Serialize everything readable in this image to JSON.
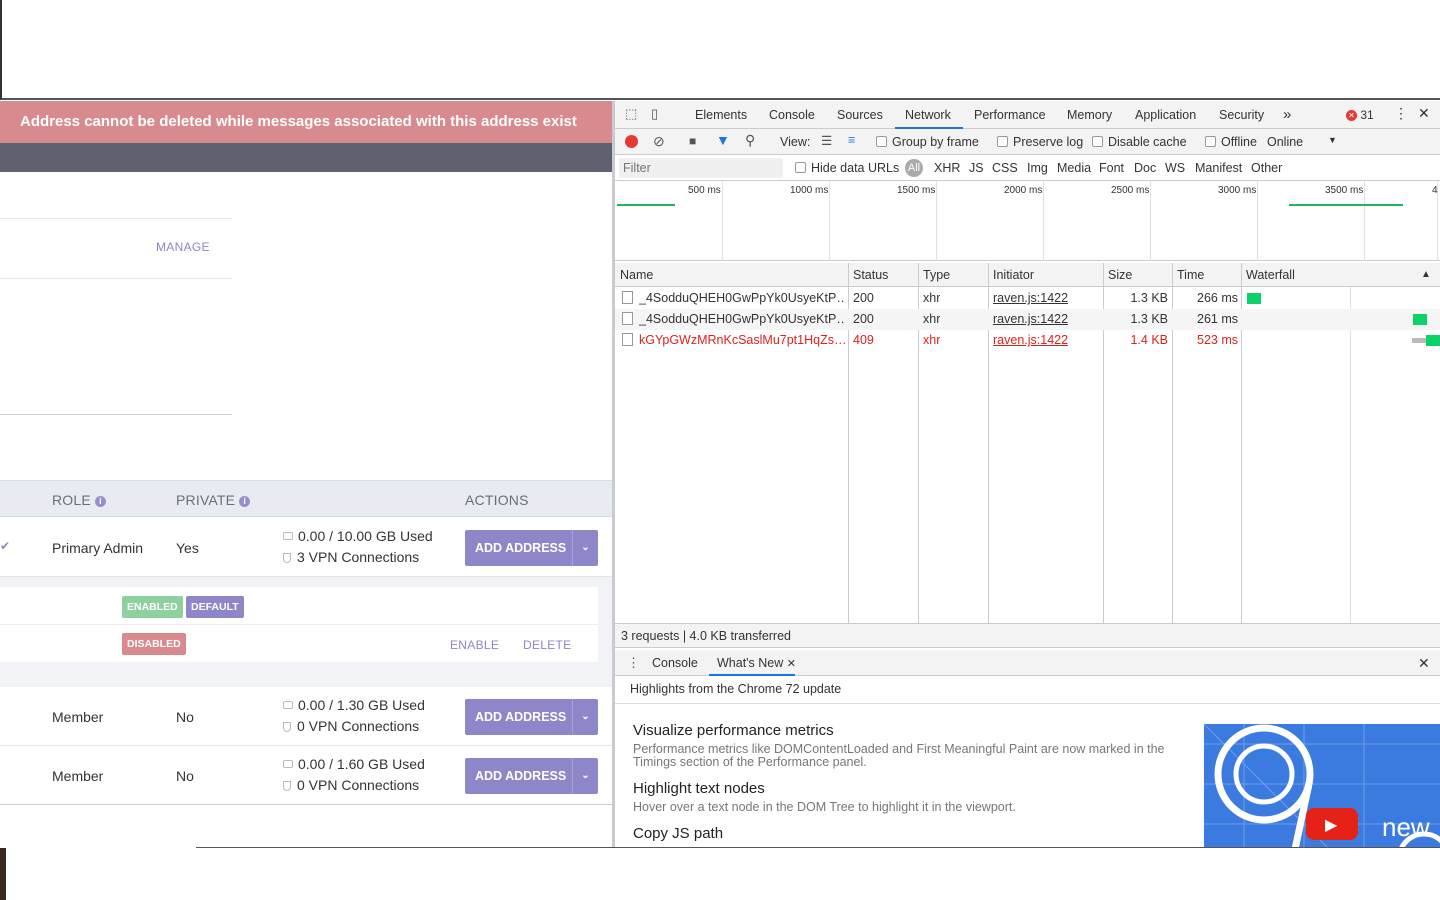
{
  "app": {
    "alert_text": "Address cannot be deleted while messages associated with this address exist",
    "manage_label": "MANAGE",
    "table_headers": {
      "role": "ROLE",
      "private": "PRIVATE",
      "actions": "ACTIONS"
    },
    "members": [
      {
        "role": "Primary Admin",
        "private": "Yes",
        "storage": "0.00 / 10.00 GB Used",
        "vpn": "3 VPN Connections",
        "action": "ADD ADDRESS"
      },
      {
        "role": "Member",
        "private": "No",
        "storage": "0.00 / 1.30 GB Used",
        "vpn": "0 VPN Connections",
        "action": "ADD ADDRESS"
      },
      {
        "role": "Member",
        "private": "No",
        "storage": "0.00 / 1.60 GB Used",
        "vpn": "0 VPN Connections",
        "action": "ADD ADDRESS"
      }
    ],
    "addresses": {
      "badge_enabled": "ENABLED",
      "badge_default": "DEFAULT",
      "badge_disabled": "DISABLED",
      "enable_label": "ENABLE",
      "delete_label": "DELETE"
    },
    "colors": {
      "alert": "#d98a8e",
      "accent": "#8d86c9",
      "enabled": "#8fd19e",
      "disabled": "#d98a8e"
    }
  },
  "devtools": {
    "tabs": [
      "Elements",
      "Console",
      "Sources",
      "Network",
      "Performance",
      "Memory",
      "Application",
      "Security"
    ],
    "active_tab": "Network",
    "more_tabs": "»",
    "error_count": "31",
    "toolbar": {
      "view_label": "View:",
      "group_by_frame": "Group by frame",
      "preserve_log": "Preserve log",
      "disable_cache": "Disable cache",
      "offline": "Offline",
      "throttle": "Online"
    },
    "filter": {
      "placeholder": "Filter",
      "hide_data_urls": "Hide data URLs",
      "all": "All",
      "types": [
        "XHR",
        "JS",
        "CSS",
        "Img",
        "Media",
        "Font",
        "Doc",
        "WS",
        "Manifest",
        "Other"
      ]
    },
    "overview_ticks": [
      "500 ms",
      "1000 ms",
      "1500 ms",
      "2000 ms",
      "2500 ms",
      "3000 ms",
      "3500 ms",
      "4"
    ],
    "columns": {
      "name": "Name",
      "status": "Status",
      "type": "Type",
      "initiator": "Initiator",
      "size": "Size",
      "time": "Time",
      "waterfall": "Waterfall"
    },
    "requests": [
      {
        "name": "_4SodduQHEH0GwPpYk0UsyeKtP…",
        "status": "200",
        "type": "xhr",
        "initiator": "raven.js:1422",
        "size": "1.3 KB",
        "time": "266 ms",
        "error": false
      },
      {
        "name": "_4SodduQHEH0GwPpYk0UsyeKtP…",
        "status": "200",
        "type": "xhr",
        "initiator": "raven.js:1422",
        "size": "1.3 KB",
        "time": "261 ms",
        "error": false
      },
      {
        "name": "kGYpGWzMRnKcSaslMu7pt1HqZs…",
        "status": "409",
        "type": "xhr",
        "initiator": "raven.js:1422",
        "size": "1.4 KB",
        "time": "523 ms",
        "error": true
      }
    ],
    "status_bar": "3 requests | 4.0 KB transferred",
    "drawer": {
      "tabs": [
        "Console",
        "What's New"
      ],
      "active": "What's New",
      "subtitle": "Highlights from the Chrome 72 update",
      "items": [
        {
          "title": "Visualize performance metrics",
          "desc": "Performance metrics like DOMContentLoaded and First Meaningful Paint are now marked in the Timings section of the Performance panel."
        },
        {
          "title": "Highlight text nodes",
          "desc": "Hover over a text node in the DOM Tree to highlight it in the viewport."
        },
        {
          "title": "Copy JS path",
          "desc": ""
        }
      ],
      "video_caption": "new"
    }
  }
}
